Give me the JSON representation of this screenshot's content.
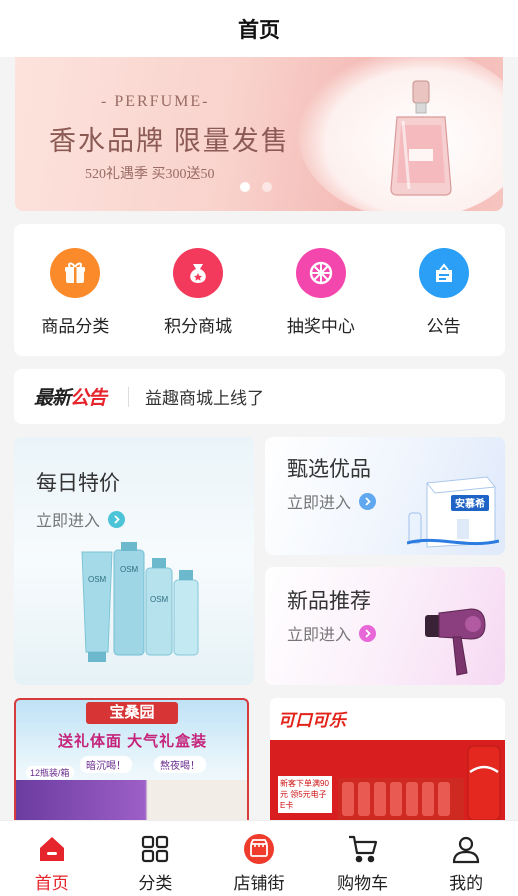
{
  "header": {
    "title": "首页"
  },
  "banner": {
    "sub": "- PERFUME-",
    "headline": "香水品牌 限量发售",
    "promo": "520礼遇季 买300送50"
  },
  "quick_links": [
    {
      "label": "商品分类",
      "icon": "gift-icon",
      "color": "#fb8a2b"
    },
    {
      "label": "积分商城",
      "icon": "points-bag-icon",
      "color": "#f33a5c"
    },
    {
      "label": "抽奖中心",
      "icon": "lottery-wheel-icon",
      "color": "#f347ae"
    },
    {
      "label": "公告",
      "icon": "notice-icon",
      "color": "#2b9ff5"
    }
  ],
  "notice": {
    "logo_a": "最新",
    "logo_b": "公告",
    "text": "益趣商城上线了"
  },
  "cards": {
    "daily": {
      "title": "每日特价",
      "link": "立即进入",
      "product_text": "OSM"
    },
    "select": {
      "title": "甄选优品",
      "link": "立即进入",
      "product_text": "安慕希"
    },
    "new": {
      "title": "新品推荐",
      "link": "立即进入"
    }
  },
  "ads": {
    "left": {
      "brand": "宝桑园",
      "slogan": "送礼体面 大气礼盒装",
      "tag1": "暗沉喝！",
      "tag2": "熬夜喝！",
      "badge": "12瓶装/箱"
    },
    "right": {
      "brand": "可口可乐",
      "promo": "新客下单满90元 领5元电子E卡"
    }
  },
  "tabbar": [
    {
      "label": "首页",
      "icon": "home-icon",
      "active": true
    },
    {
      "label": "分类",
      "icon": "category-grid-icon",
      "active": false
    },
    {
      "label": "店铺街",
      "icon": "shop-street-icon",
      "active": false
    },
    {
      "label": "购物车",
      "icon": "cart-icon",
      "active": false
    },
    {
      "label": "我的",
      "icon": "user-icon",
      "active": false
    }
  ],
  "colors": {
    "accent": "#e5242b",
    "link_blue": "#5fa8f0",
    "link_pink": "#e766d8",
    "link_teal": "#4cc3d6"
  }
}
